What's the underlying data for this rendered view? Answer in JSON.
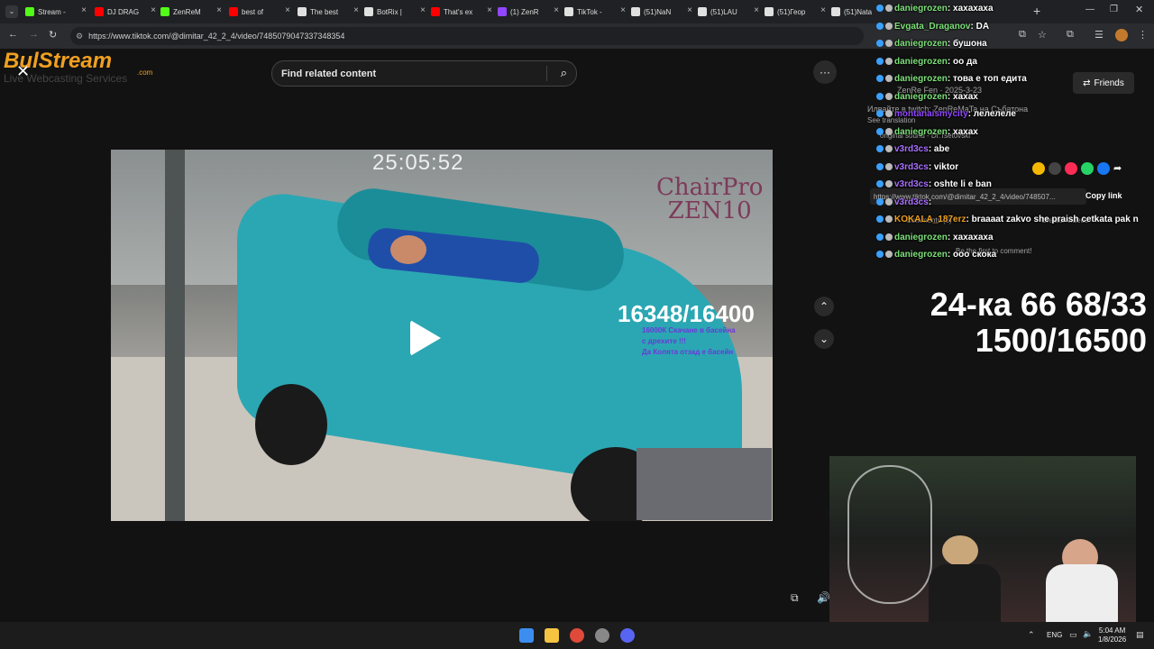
{
  "browser": {
    "tabs": [
      {
        "label": "Stream -",
        "color": "#53fc18"
      },
      {
        "label": "DJ DRAG",
        "color": "#ff0000"
      },
      {
        "label": "ZenReM",
        "color": "#53fc18"
      },
      {
        "label": "best of",
        "color": "#ff0000"
      },
      {
        "label": "The best",
        "color": "#e0e0e0"
      },
      {
        "label": "BotRix |",
        "color": "#e0e0e0"
      },
      {
        "label": "That's ex",
        "color": "#ff0000"
      },
      {
        "label": "(1) ZenR",
        "color": "#9146ff"
      },
      {
        "label": "TikTok -",
        "color": "#e0e0e0"
      },
      {
        "label": "(51)NaN",
        "color": "#e0e0e0"
      },
      {
        "label": "(51)LAU",
        "color": "#e0e0e0"
      },
      {
        "label": "(51)Геор",
        "color": "#e0e0e0"
      },
      {
        "label": "(51)Nata",
        "color": "#e0e0e0"
      }
    ],
    "new_tab": "+",
    "url": "https://www.tiktok.com/@dimitar_42_2_4/video/7485079047337348354"
  },
  "tiktok": {
    "search_placeholder": "Find related content",
    "more_icon": "···",
    "share_link": "https://www.tiktok.com/@dimitar_42_2_4/video/748507...",
    "copy_link": "Copy link",
    "author_line": "ZenRe Fen · 2025-3-23",
    "desc_line": "Илвайте в twitch: ZenReMaTa на Събатона",
    "see_translation": "See translation",
    "sound": "original sound - Dr.Tsetovski",
    "comments": "Comments (0)",
    "login_comment": "Be the first to comment!",
    "creator_videos": "Creator videos"
  },
  "overlay": {
    "brand": "BulStream",
    "brand_sub": "Live Webcasting Services",
    "brand_com": ".com"
  },
  "video": {
    "timer": "25:05:52",
    "chairpro_line1": "ChairPro",
    "chairpro_line2": "ZEN10",
    "counter": "16348/16400",
    "annotation1": "16000К Скачане в басейна",
    "annotation2": "с дрехите !!!",
    "annotation3": "Да Колята отзад е басейн"
  },
  "chat": {
    "messages": [
      {
        "user": "daniegrozen",
        "text": ": хахахаха"
      },
      {
        "user": "Evgata_Draganov",
        "text": ": DA"
      },
      {
        "user": "daniegrozen",
        "text": ": бушона"
      },
      {
        "user": "daniegrozen",
        "text": ": оо да"
      },
      {
        "user": "daniegrozen",
        "text": ": това е топ едита"
      },
      {
        "user": "daniegrozen",
        "text": ": хахах"
      },
      {
        "user": "montanaismycity",
        "text": ": лелелеле"
      },
      {
        "user": "daniegrozen",
        "text": ": хахах"
      },
      {
        "user": "v3rd3cs",
        "text": ": abe"
      },
      {
        "user": "v3rd3cs",
        "text": ": viktor"
      },
      {
        "user": "v3rd3cs",
        "text": ": oshte li e ban"
      },
      {
        "user": "v3rd3cs",
        "text": ":"
      },
      {
        "user": "KOKALA_187erz",
        "text": ": braaaat zakvo she praish cetkata pak n"
      },
      {
        "user": "daniegrozen",
        "text": ": хахахаха"
      },
      {
        "user": "daniegrozen",
        "text": ": ооо скока"
      }
    ],
    "user_colors": {
      "daniegrozen": "#7de07a",
      "Evgata_Draganov": "#7de07a",
      "montanaismycity": "#9146ff",
      "v3rd3cs": "#a970ff",
      "KOKALA_187erz": "#f0a020"
    }
  },
  "friends_button": "Friends",
  "stream_stats": {
    "line1": "24-ка 66 68/33",
    "line2": "1500/16500"
  },
  "taskbar": {
    "lang": "ENG",
    "time": "5:04 AM",
    "date": "1/8/2026"
  }
}
